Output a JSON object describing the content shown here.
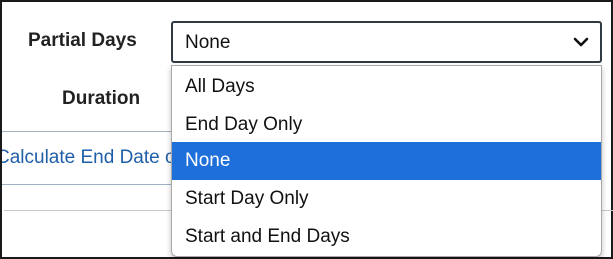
{
  "form": {
    "partial_days_label": "Partial Days",
    "duration_label": "Duration",
    "calculate_button_label": "Calculate End Date or Duration"
  },
  "partial_days_select": {
    "selected_value": "None",
    "options": [
      {
        "label": "All Days",
        "selected": false
      },
      {
        "label": "End Day Only",
        "selected": false
      },
      {
        "label": "None",
        "selected": true
      },
      {
        "label": "Start Day Only",
        "selected": false
      },
      {
        "label": "Start and End Days",
        "selected": false
      }
    ]
  },
  "colors": {
    "selected_option_bg": "#1e6fd9",
    "link_text": "#1f5fa8",
    "select_border": "#2f3a44"
  },
  "icons": {
    "select_chevron": "chevron-down-icon"
  }
}
